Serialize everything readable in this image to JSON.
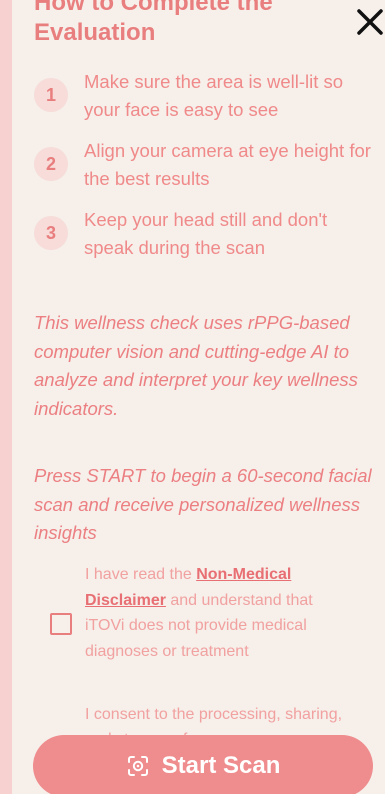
{
  "modal": {
    "title": "How to Complete the Evaluation",
    "close_icon": "close-icon"
  },
  "steps": [
    {
      "number": "1",
      "text": "Make sure the area is well-lit so your face is easy to see"
    },
    {
      "number": "2",
      "text": "Align your camera at eye height for the best results"
    },
    {
      "number": "3",
      "text": "Keep your head still and don't speak during the scan"
    }
  ],
  "description": "This wellness check uses rPPG-based computer vision and cutting-edge AI to analyze and interpret your key wellness indicators.",
  "instruction": "Press START to begin a 60-second facial scan and receive personalized wellness insights",
  "disclaimer": {
    "prefix": "I have read the ",
    "link_text": "Non-Medical Disclaimer",
    "suffix": " and understand that iTOVi does not provide medical diagnoses or treatment",
    "checked": false
  },
  "consent_partial": "I consent to the processing, sharing, and storage of my",
  "start_button": {
    "label": "Start Scan",
    "icon": "scan-face-icon"
  },
  "colors": {
    "accent": "#e97e7f",
    "button": "#ef8c8d",
    "background": "#f6efea",
    "side_strip": "#f7d0d0"
  }
}
